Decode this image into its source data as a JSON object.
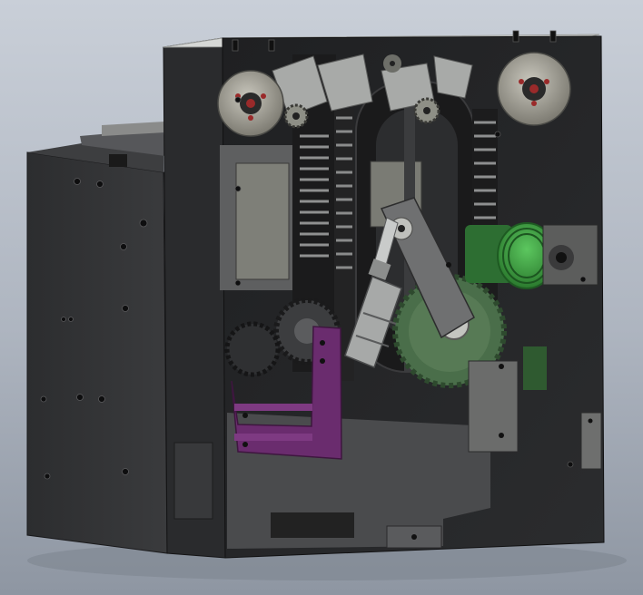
{
  "scene": {
    "subject": "mechanical-assembly-cad-render",
    "colors": {
      "background_top": "#c9cfd8",
      "background_mid": "#aeb5c0",
      "background_bottom": "#8e96a2",
      "housing_dark": "#262628",
      "housing_side": "#343537",
      "plate_grey": "#4b4c4e",
      "panel_light": "#7f8078",
      "metal_light": "#d3d5d2",
      "gear_green": "#4a6e4a",
      "spring_green": "#3fa043",
      "bracket_purple": "#6a2c6e",
      "accent_red": "#9a2a2a"
    }
  }
}
